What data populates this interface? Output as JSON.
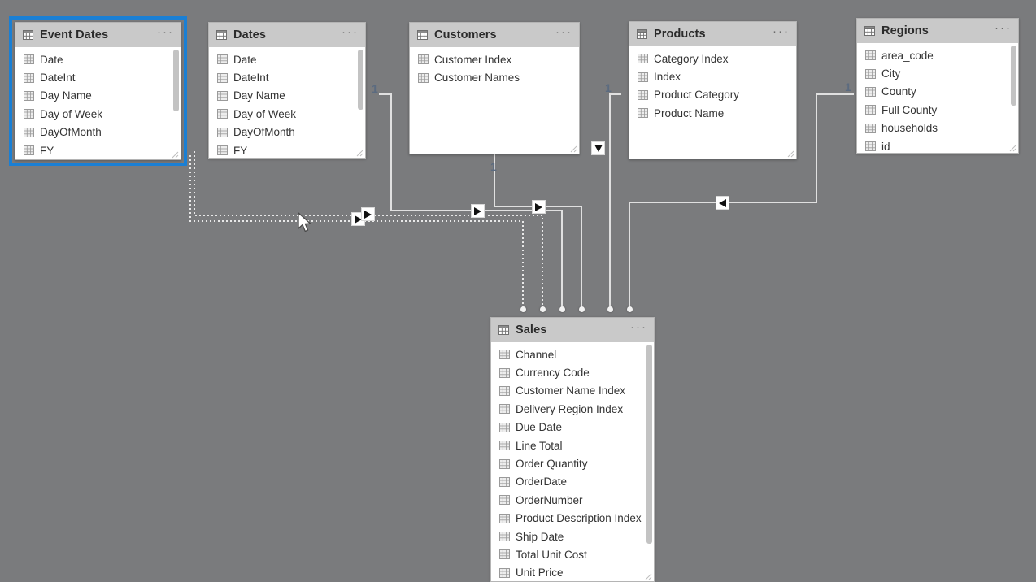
{
  "app": {
    "view_name": "Model view",
    "canvas_background": "#7a7b7d",
    "selection_color": "#1a7fd4",
    "cardinality_color": "#5b6b80",
    "header_color": "#c9c9c9"
  },
  "tables": [
    {
      "id": "event-dates",
      "name": "Event Dates",
      "selected": true,
      "ellipsis": "···",
      "fields": [
        "Date",
        "DateInt",
        "Day Name",
        "Day of Week",
        "DayOfMonth",
        "FY"
      ],
      "has_scrollbar": true
    },
    {
      "id": "dates",
      "name": "Dates",
      "selected": false,
      "ellipsis": "···",
      "fields": [
        "Date",
        "DateInt",
        "Day Name",
        "Day of Week",
        "DayOfMonth",
        "FY"
      ],
      "has_scrollbar": true
    },
    {
      "id": "customers",
      "name": "Customers",
      "selected": false,
      "ellipsis": "···",
      "fields": [
        "Customer Index",
        "Customer Names"
      ],
      "has_scrollbar": false
    },
    {
      "id": "products",
      "name": "Products",
      "selected": false,
      "ellipsis": "···",
      "fields": [
        "Category Index",
        "Index",
        "Product Category",
        "Product Name"
      ],
      "has_scrollbar": false
    },
    {
      "id": "regions",
      "name": "Regions",
      "selected": false,
      "ellipsis": "···",
      "fields": [
        "area_code",
        "City",
        "County",
        "Full County",
        "households",
        "id"
      ],
      "has_scrollbar": true
    },
    {
      "id": "sales",
      "name": "Sales",
      "selected": false,
      "ellipsis": "···",
      "fields": [
        "Channel",
        "Currency Code",
        "Customer Name Index",
        "Delivery Region Index",
        "Due Date",
        "Line Total",
        "Order Quantity",
        "OrderDate",
        "OrderNumber",
        "Product Description Index",
        "Ship Date",
        "Total Unit Cost",
        "Unit Price"
      ],
      "has_scrollbar": true
    }
  ],
  "cardinality_labels": [
    {
      "id": "card-dates",
      "text": "1"
    },
    {
      "id": "card-customers-left",
      "text": "1"
    },
    {
      "id": "card-customers-bottom",
      "text": "1"
    },
    {
      "id": "card-products",
      "text": "1"
    },
    {
      "id": "card-regions",
      "text": "1"
    }
  ],
  "relationships": [
    {
      "from": "Event Dates",
      "to": "Sales",
      "style": "inactive",
      "cardinality": "one-to-many",
      "direction": "single"
    },
    {
      "from": "Event Dates",
      "to": "Sales",
      "style": "inactive",
      "cardinality": "one-to-many",
      "direction": "single"
    },
    {
      "from": "Dates",
      "to": "Sales",
      "style": "active",
      "cardinality": "one-to-many",
      "direction": "single"
    },
    {
      "from": "Customers",
      "to": "Sales",
      "style": "active",
      "cardinality": "one-to-many",
      "direction": "single"
    },
    {
      "from": "Products",
      "to": "Sales",
      "style": "active",
      "cardinality": "one-to-many",
      "direction": "single"
    },
    {
      "from": "Regions",
      "to": "Sales",
      "style": "active",
      "cardinality": "one-to-many",
      "direction": "single"
    }
  ],
  "icons": {
    "table_glyph": "table-grid-icon",
    "more_options": "ellipsis-icon",
    "cursor": "mouse-pointer-icon",
    "filter_arrow": "filter-direction-arrow-icon"
  }
}
